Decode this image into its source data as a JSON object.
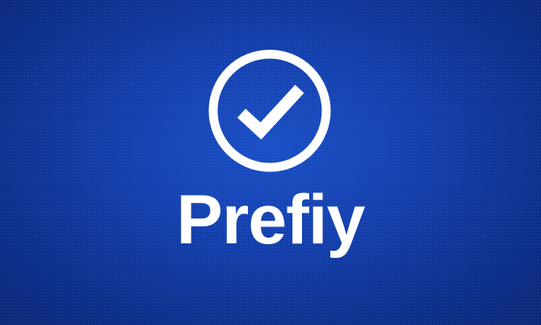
{
  "brand": {
    "name": "Prefiy",
    "logo_icon": "check-circle-icon"
  },
  "colors": {
    "background": "#1441b0",
    "background_dark": "#0a2877",
    "foreground": "#ffffff"
  }
}
